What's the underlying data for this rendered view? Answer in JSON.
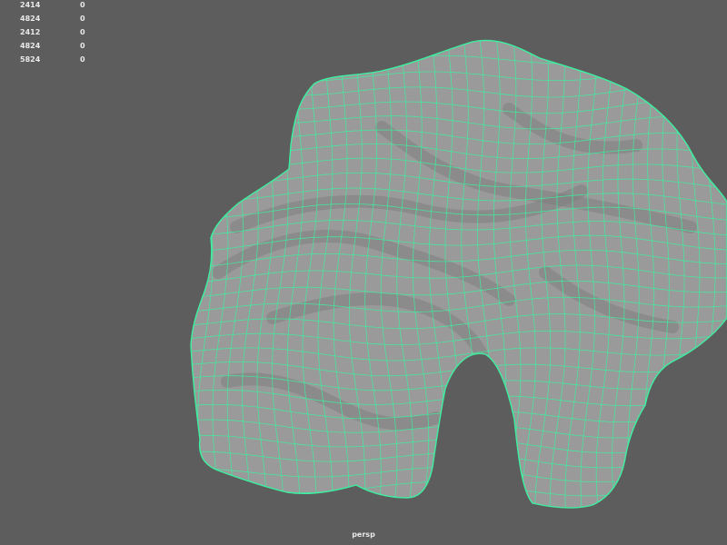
{
  "hud": {
    "rows": [
      {
        "label": "2414",
        "value": "0"
      },
      {
        "label": "4824",
        "value": "0"
      },
      {
        "label": "2412",
        "value": "0"
      },
      {
        "label": "4824",
        "value": "0"
      },
      {
        "label": "5824",
        "value": "0"
      }
    ]
  },
  "viewport": {
    "camera_label": "persp",
    "background_color": "#5d5d5d",
    "mesh_fill_color": "#9a9a9a",
    "mesh_dark_color": "#7f7f7f",
    "wire_color": "#3cf0a0"
  }
}
